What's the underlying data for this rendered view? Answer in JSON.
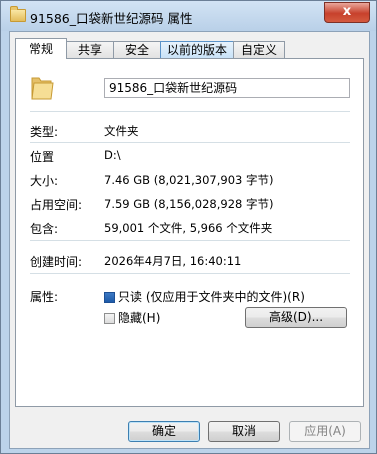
{
  "window": {
    "title": "91586_口袋新世纪源码 属性",
    "close_label": "x"
  },
  "tabs": [
    {
      "label": "常规"
    },
    {
      "label": "共享"
    },
    {
      "label": "安全"
    },
    {
      "label": "以前的版本"
    },
    {
      "label": "自定义"
    }
  ],
  "general": {
    "folder_name": "91586_口袋新世纪源码",
    "type_label": "类型:",
    "type_value": "文件夹",
    "location_label": "位置",
    "location_value": "D:\\",
    "size_label": "大小:",
    "size_value": "7.46 GB (8,021,307,903 字节)",
    "size_on_disk_label": "占用空间:",
    "size_on_disk_value": "7.59 GB (8,156,028,928 字节)",
    "contains_label": "包含:",
    "contains_value": "59,001 个文件, 5,966 个文件夹",
    "created_label": "创建时间:",
    "created_value": "2026年4月7日, 16:40:11",
    "attributes_label": "属性:",
    "readonly_label": "只读 (仅应用于文件夹中的文件)(R)",
    "readonly_checked": true,
    "hidden_label": "隐藏(H)",
    "hidden_checked": false,
    "advanced_label": "高级(D)..."
  },
  "footer": {
    "ok_label": "确定",
    "cancel_label": "取消",
    "apply_label": "应用(A)"
  },
  "colors": {
    "frame": "#bcd3ea",
    "close": "#c7412c",
    "checkbox_checked": "#1d5aa8"
  }
}
